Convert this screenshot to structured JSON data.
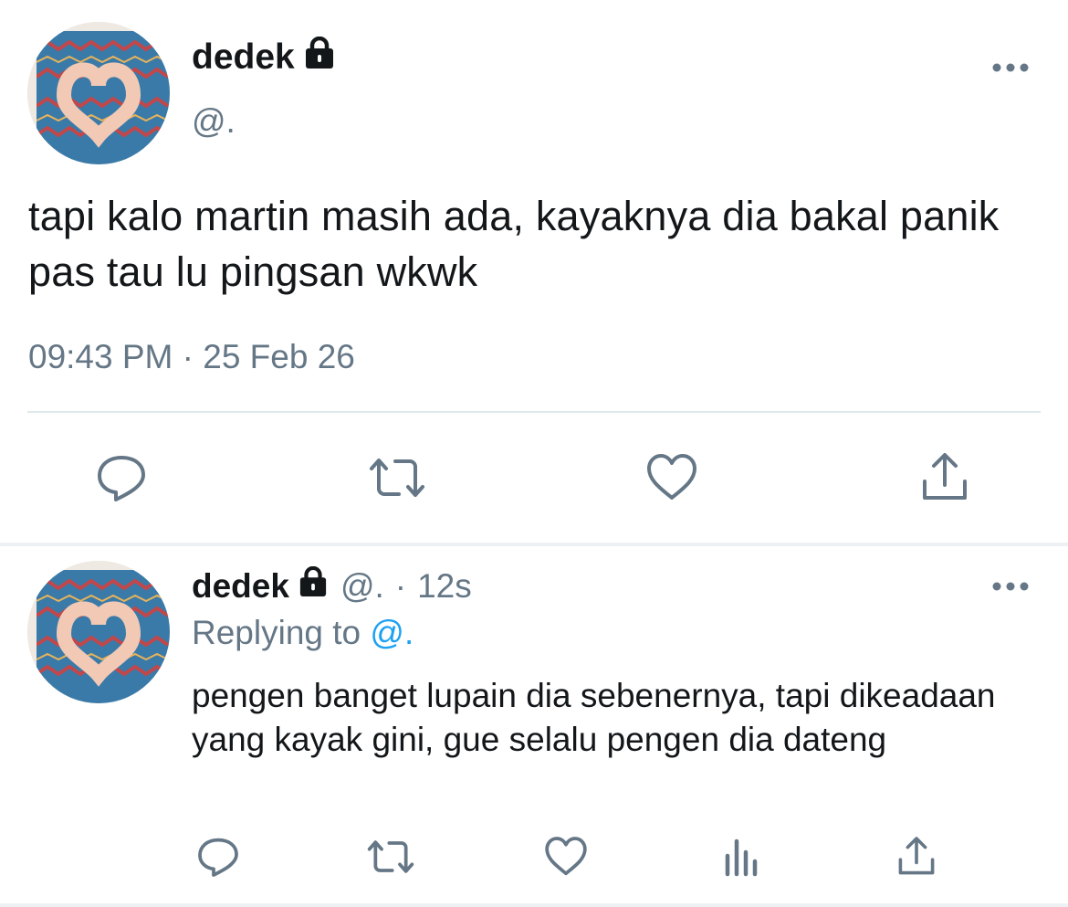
{
  "main_tweet": {
    "author": {
      "display_name": "dedek",
      "handle": "@.",
      "avatar_icon": "avatar-heart-hands",
      "protected_icon": "lock-icon"
    },
    "text": "tapi kalo martin masih ada, kayaknya dia bakal panik pas tau lu pingsan wkwk",
    "timestamp": "09:43 PM · 25 Feb 26",
    "actions": [
      {
        "icon": "reply-icon"
      },
      {
        "icon": "retweet-icon"
      },
      {
        "icon": "like-icon"
      },
      {
        "icon": "share-icon"
      }
    ],
    "menu_icon": "more-icon"
  },
  "reply_tweet": {
    "author": {
      "display_name": "dedek",
      "handle": "@.",
      "separator": "·",
      "time_ago": "12s",
      "avatar_icon": "avatar-heart-hands",
      "protected_icon": "lock-icon"
    },
    "replying_prefix": "Replying to",
    "replying_to": "@.",
    "text": "pengen banget lupain dia sebenernya, tapi dikeadaan yang kayak gini, gue selalu pengen dia dateng",
    "actions": [
      {
        "icon": "reply-icon"
      },
      {
        "icon": "retweet-icon"
      },
      {
        "icon": "like-icon"
      },
      {
        "icon": "analytics-icon"
      },
      {
        "icon": "share-icon"
      }
    ],
    "menu_icon": "more-icon"
  },
  "colors": {
    "text_primary": "#14171a",
    "text_secondary": "#657786",
    "link": "#1da1f2",
    "divider": "#e1e8ed",
    "icon": "#657786"
  }
}
